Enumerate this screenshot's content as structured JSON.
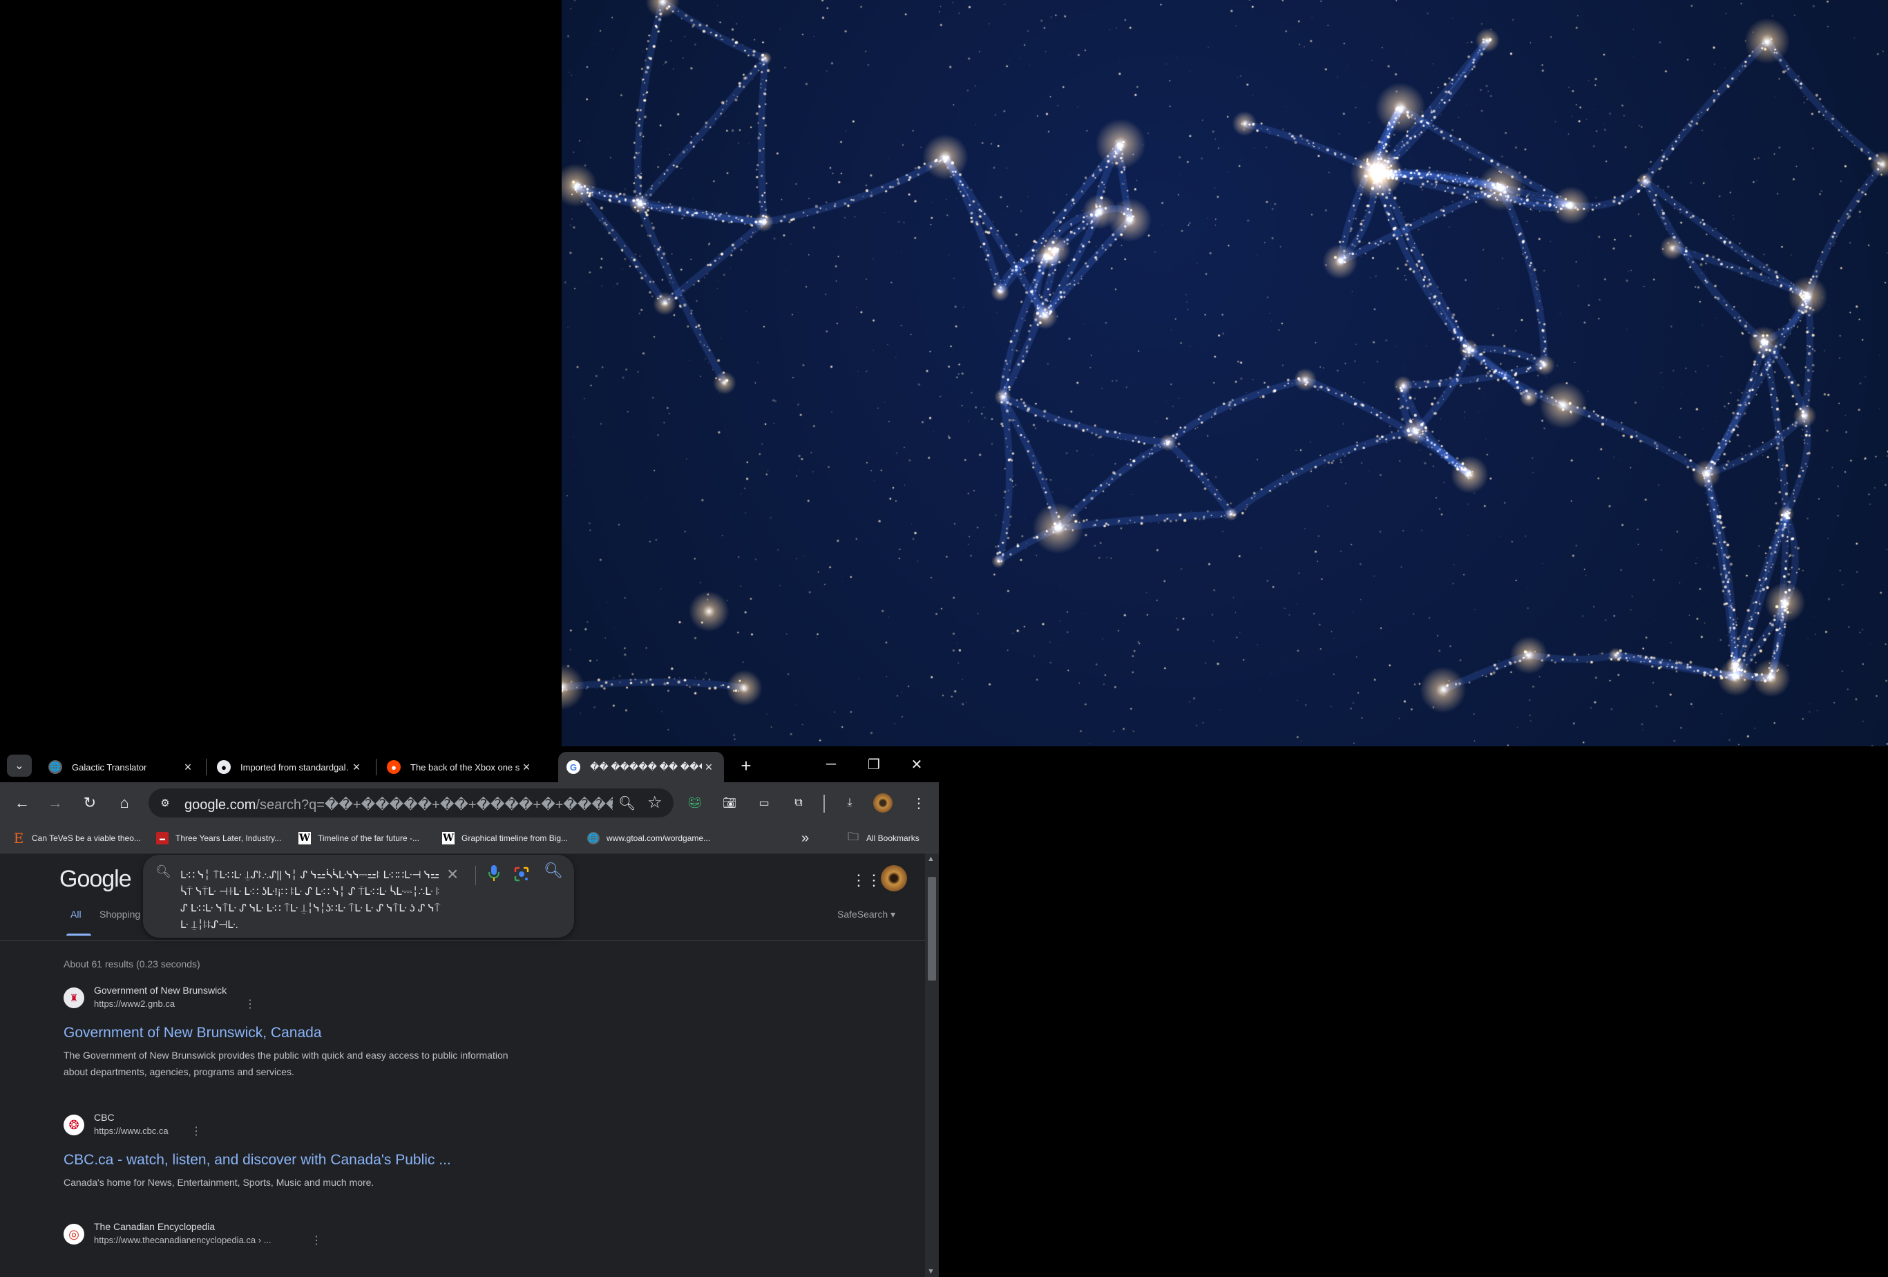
{
  "tabs": [
    {
      "title": "Galactic Translator",
      "icon": "globe-icon"
    },
    {
      "title": "Imported from standardgal…",
      "icon": "github-icon"
    },
    {
      "title": "The back of the Xbox one s…",
      "icon": "reddit-icon"
    },
    {
      "title": "�� ����� �� ����",
      "icon": "google-icon"
    }
  ],
  "address_bar": {
    "host": "google.com",
    "path": "/search?q=��+�����+��+����+�+����..."
  },
  "bookmarks": [
    {
      "label": "Can TeVeS be a viable theo...",
      "icon": "etsy-e-icon"
    },
    {
      "label": "Three Years Later, Industry...",
      "icon": "red-badge-icon"
    },
    {
      "label": "Timeline of the far future -...",
      "icon": "wikipedia-icon"
    },
    {
      "label": "Graphical timeline from Big...",
      "icon": "wikipedia-icon"
    },
    {
      "label": "www.gtoal.com/wordgame...",
      "icon": "globe-icon"
    }
  ],
  "bookmarks_more": "»",
  "all_bookmarks": "All Bookmarks",
  "google": {
    "logo": "Google",
    "query": "ᒷ∷ ᓭ╎ ⍑ᒷ∷ᒷ ⍊ᔑꖎ∴ᔑ|| ᓭ╎ ᔑ ᓭ⚍ᓵᓵᒷᓭᓭ⎓⚍ꖎ ᒷ∷∷ᒷ⊣ ᓭ⚍ᓵ⍑ ᓭ⍑ᒷ ⊣ꖌᒷ ᒷ∷ ʖᒷ!¡∷ ꖎᒷ ᔑ ᒷ∷ ᓭ╎ ᔑ ⍑ᒷ∷ᒷ ᓵᒷ⎓╎∴ᒷ ꖎᔑ ᒷ∷ᒷ ᓭ⍑ᒷ ᔑ ᓭᒷ ᒷ∷ ⍑ᒷ ⍊╎ᓭ╎ʖ∷ᒷ ⍑ᒷ ᒷ ᔑ ᓭ⍑ᒷ ʖ ᔑ ᓭ⍑ᒷ ⍊╎ꖎꖎᔑ⊣ᒷ.",
    "tab_all": "All",
    "tab_shopping": "Shopping",
    "safesearch": "SafeSearch",
    "stats": "About 61 results (0.23 seconds)"
  },
  "results": [
    {
      "site_name": "Government of New Brunswick",
      "url": "https://www2.gnb.ca",
      "title": "Government of New Brunswick, Canada",
      "snippet": "The Government of New Brunswick provides the public with quick and easy access to public information about departments, agencies, programs and services.",
      "icon": "gnb-crest-icon"
    },
    {
      "site_name": "CBC",
      "url": "https://www.cbc.ca",
      "title": "CBC.ca - watch, listen, and discover with Canada's Public ...",
      "snippet": "Canada's home for News, Entertainment, Sports, Music and much more.",
      "icon": "cbc-gem-icon"
    },
    {
      "site_name": "The Canadian Encyclopedia",
      "url": "https://www.thecanadianencyclopedia.ca › ...",
      "title": "",
      "snippet": "",
      "icon": "canadian-encyclopedia-icon"
    }
  ],
  "colors": {
    "accent": "#8ab4f8",
    "page_bg": "#202124",
    "toolbar_bg": "#35363a",
    "wallpaper_bg": "#071229",
    "galaxy_glow": "#ffd98a"
  }
}
